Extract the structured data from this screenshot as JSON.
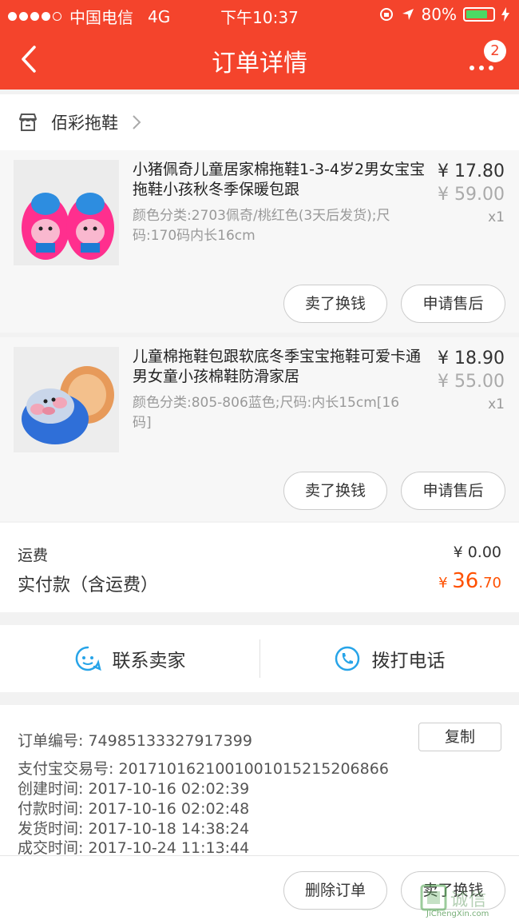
{
  "status_bar": {
    "carrier": "中国电信",
    "network": "4G",
    "time": "下午10:37",
    "battery_percent": "80%",
    "battery_level": 0.8
  },
  "nav": {
    "title": "订单详情",
    "badge_count": "2"
  },
  "shop": {
    "name": "佰彩拖鞋"
  },
  "items": [
    {
      "title": "小猪佩奇儿童居家棉拖鞋1-3-4岁2男女宝宝拖鞋小孩秋冬季保暖包跟",
      "sku": "颜色分类:2703佩奇/桃红色(3天后发货);尺码:170码内长16cm",
      "price": "¥ 17.80",
      "original_price": "¥ 59.00",
      "qty": "x1",
      "btn_sell": "卖了换钱",
      "btn_aftersale": "申请售后"
    },
    {
      "title": "儿童棉拖鞋包跟软底冬季宝宝拖鞋可爱卡通男女童小孩棉鞋防滑家居",
      "sku": "颜色分类:805-806蓝色;尺码:内长15cm[16码]",
      "price": "¥ 18.90",
      "original_price": "¥ 55.00",
      "qty": "x1",
      "btn_sell": "卖了换钱",
      "btn_aftersale": "申请售后"
    }
  ],
  "fee": {
    "shipping_label": "运费",
    "shipping_value": "¥ 0.00",
    "paid_label": "实付款（含运费）",
    "paid_symbol": "¥ ",
    "paid_integer": "36",
    "paid_decimal": ".70"
  },
  "contact": {
    "seller": "联系卖家",
    "phone": "拨打电话"
  },
  "order_info": {
    "order_no": "订单编号:   74985133327917399",
    "copy": "复制",
    "alipay_no": "支付宝交易号:   2017101621001001015215206866",
    "created": "创建时间:   2017-10-16 02:02:39",
    "paid": "付款时间:   2017-10-16 02:02:48",
    "shipped": "发货时间:   2017-10-18 14:38:24",
    "completed": "成交时间:   2017-10-24 11:13:44"
  },
  "bottom": {
    "delete_order": "删除订单",
    "sell": "卖了换钱"
  },
  "watermark": {
    "text": "诚信",
    "url": "JiChengXin.com"
  },
  "colors": {
    "brand": "#f4442c",
    "price_accent": "#ff5000",
    "contact_icon": "#27a4e8"
  }
}
